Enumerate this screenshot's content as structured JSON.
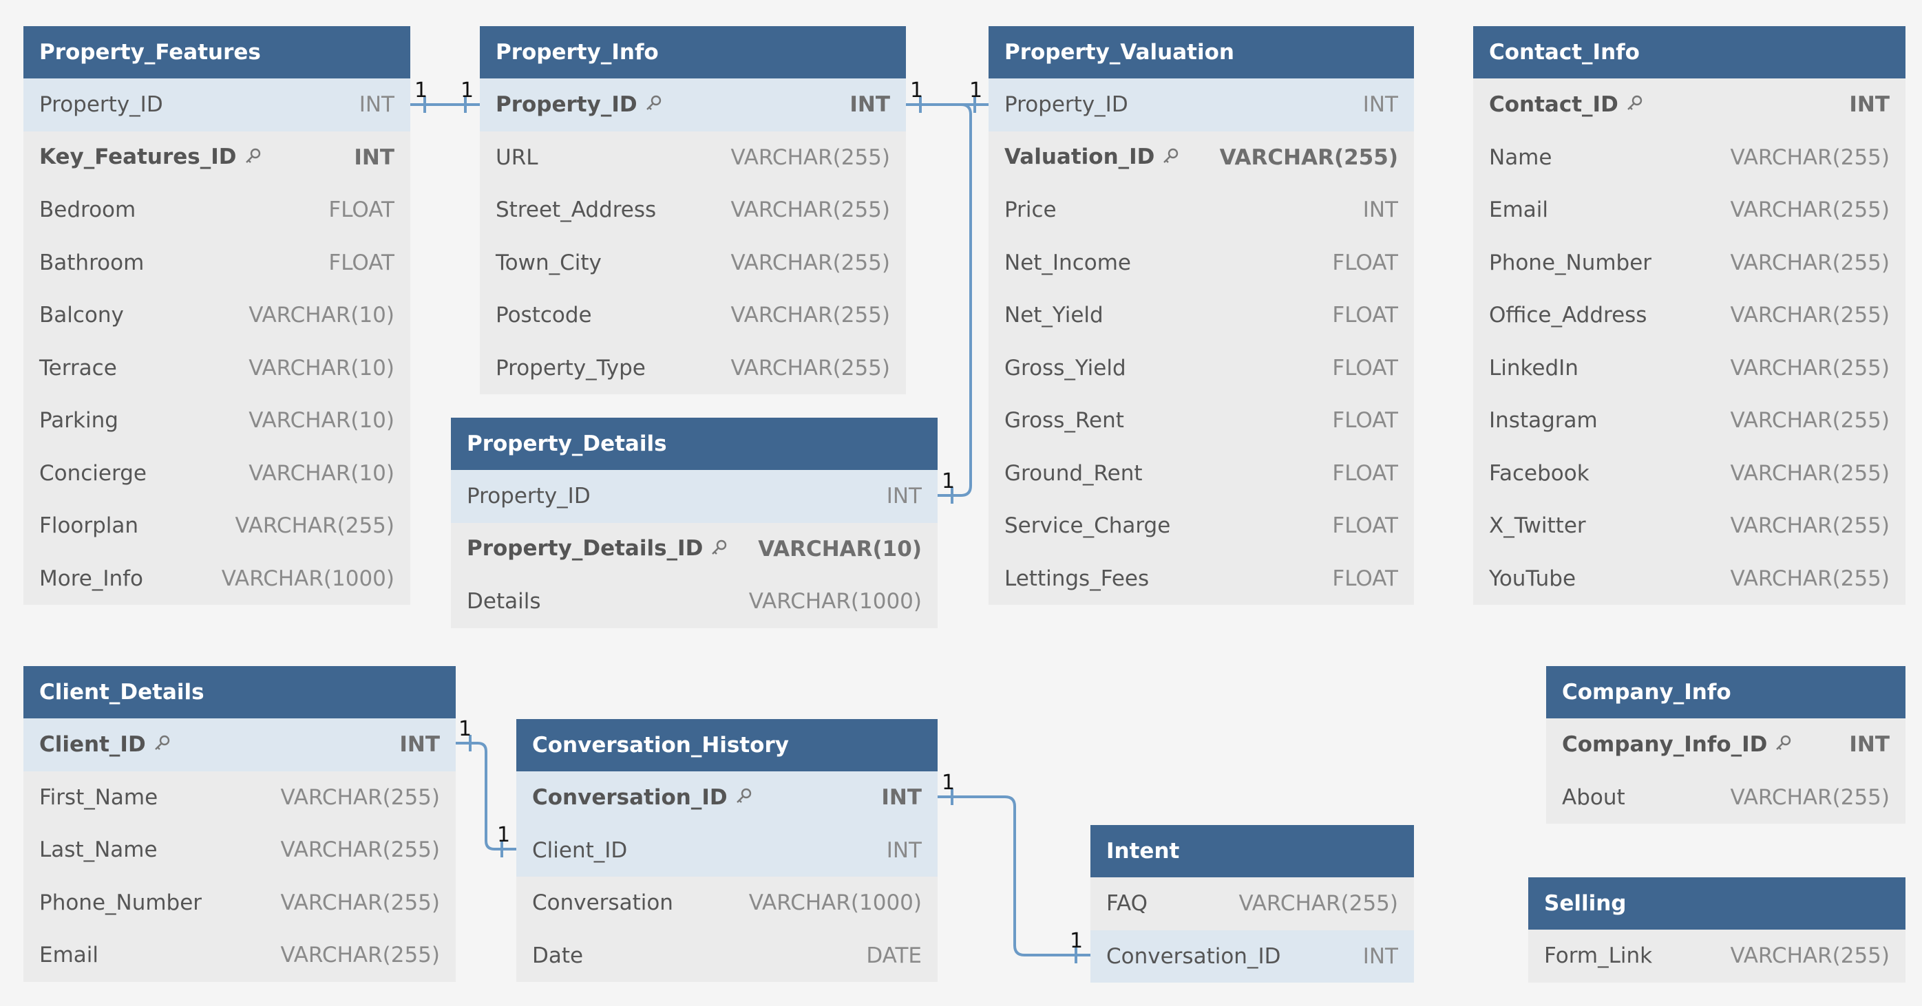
{
  "tables": {
    "property_features": {
      "title": "Property_Features",
      "rows": [
        {
          "name": "Property_ID",
          "type": "INT"
        },
        {
          "name": "Key_Features_ID",
          "type": "INT"
        },
        {
          "name": "Bedroom",
          "type": "FLOAT"
        },
        {
          "name": "Bathroom",
          "type": "FLOAT"
        },
        {
          "name": "Balcony",
          "type": "VARCHAR(10)"
        },
        {
          "name": "Terrace",
          "type": "VARCHAR(10)"
        },
        {
          "name": "Parking",
          "type": "VARCHAR(10)"
        },
        {
          "name": "Concierge",
          "type": "VARCHAR(10)"
        },
        {
          "name": "Floorplan",
          "type": "VARCHAR(255)"
        },
        {
          "name": "More_Info",
          "type": "VARCHAR(1000)"
        }
      ]
    },
    "property_info": {
      "title": "Property_Info",
      "rows": [
        {
          "name": "Property_ID",
          "type": "INT"
        },
        {
          "name": "URL",
          "type": "VARCHAR(255)"
        },
        {
          "name": "Street_Address",
          "type": "VARCHAR(255)"
        },
        {
          "name": "Town_City",
          "type": "VARCHAR(255)"
        },
        {
          "name": "Postcode",
          "type": "VARCHAR(255)"
        },
        {
          "name": "Property_Type",
          "type": "VARCHAR(255)"
        }
      ]
    },
    "property_details": {
      "title": "Property_Details",
      "rows": [
        {
          "name": "Property_ID",
          "type": "INT"
        },
        {
          "name": "Property_Details_ID",
          "type": "VARCHAR(10)"
        },
        {
          "name": "Details",
          "type": "VARCHAR(1000)"
        }
      ]
    },
    "property_valuation": {
      "title": "Property_Valuation",
      "rows": [
        {
          "name": "Property_ID",
          "type": "INT"
        },
        {
          "name": "Valuation_ID",
          "type": "VARCHAR(255)"
        },
        {
          "name": "Price",
          "type": "INT"
        },
        {
          "name": "Net_Income",
          "type": "FLOAT"
        },
        {
          "name": "Net_Yield",
          "type": "FLOAT"
        },
        {
          "name": "Gross_Yield",
          "type": "FLOAT"
        },
        {
          "name": "Gross_Rent",
          "type": "FLOAT"
        },
        {
          "name": "Ground_Rent",
          "type": "FLOAT"
        },
        {
          "name": "Service_Charge",
          "type": "FLOAT"
        },
        {
          "name": "Lettings_Fees",
          "type": "FLOAT"
        }
      ]
    },
    "contact_info": {
      "title": "Contact_Info",
      "rows": [
        {
          "name": "Contact_ID",
          "type": "INT"
        },
        {
          "name": "Name",
          "type": "VARCHAR(255)"
        },
        {
          "name": "Email",
          "type": "VARCHAR(255)"
        },
        {
          "name": "Phone_Number",
          "type": "VARCHAR(255)"
        },
        {
          "name": "Office_Address",
          "type": "VARCHAR(255)"
        },
        {
          "name": "LinkedIn",
          "type": "VARCHAR(255)"
        },
        {
          "name": "Instagram",
          "type": "VARCHAR(255)"
        },
        {
          "name": "Facebook",
          "type": "VARCHAR(255)"
        },
        {
          "name": "X_Twitter",
          "type": "VARCHAR(255)"
        },
        {
          "name": "YouTube",
          "type": "VARCHAR(255)"
        }
      ]
    },
    "client_details": {
      "title": "Client_Details",
      "rows": [
        {
          "name": "Client_ID",
          "type": "INT"
        },
        {
          "name": "First_Name",
          "type": "VARCHAR(255)"
        },
        {
          "name": "Last_Name",
          "type": "VARCHAR(255)"
        },
        {
          "name": "Phone_Number",
          "type": "VARCHAR(255)"
        },
        {
          "name": "Email",
          "type": "VARCHAR(255)"
        }
      ]
    },
    "conversation_history": {
      "title": "Conversation_History",
      "rows": [
        {
          "name": "Conversation_ID",
          "type": "INT"
        },
        {
          "name": "Client_ID",
          "type": "INT"
        },
        {
          "name": "Conversation",
          "type": "VARCHAR(1000)"
        },
        {
          "name": "Date",
          "type": "DATE"
        }
      ]
    },
    "intent": {
      "title": "Intent",
      "rows": [
        {
          "name": "FAQ",
          "type": "VARCHAR(255)"
        },
        {
          "name": "Conversation_ID",
          "type": "INT"
        }
      ]
    },
    "company_info": {
      "title": "Company_Info",
      "rows": [
        {
          "name": "Company_Info_ID",
          "type": "INT"
        },
        {
          "name": "About",
          "type": "VARCHAR(255)"
        }
      ]
    },
    "selling": {
      "title": "Selling",
      "rows": [
        {
          "name": "Form_Link",
          "type": "VARCHAR(255)"
        }
      ]
    }
  },
  "relationships": {
    "cardinality_label": "1"
  },
  "colors": {
    "header": "#3f6690",
    "row": "#ebebeb",
    "fk_row": "#dde7f0",
    "connector": "#6b9ac6",
    "background": "#f5f5f5"
  },
  "icons": {
    "primary_key": "key-icon"
  }
}
